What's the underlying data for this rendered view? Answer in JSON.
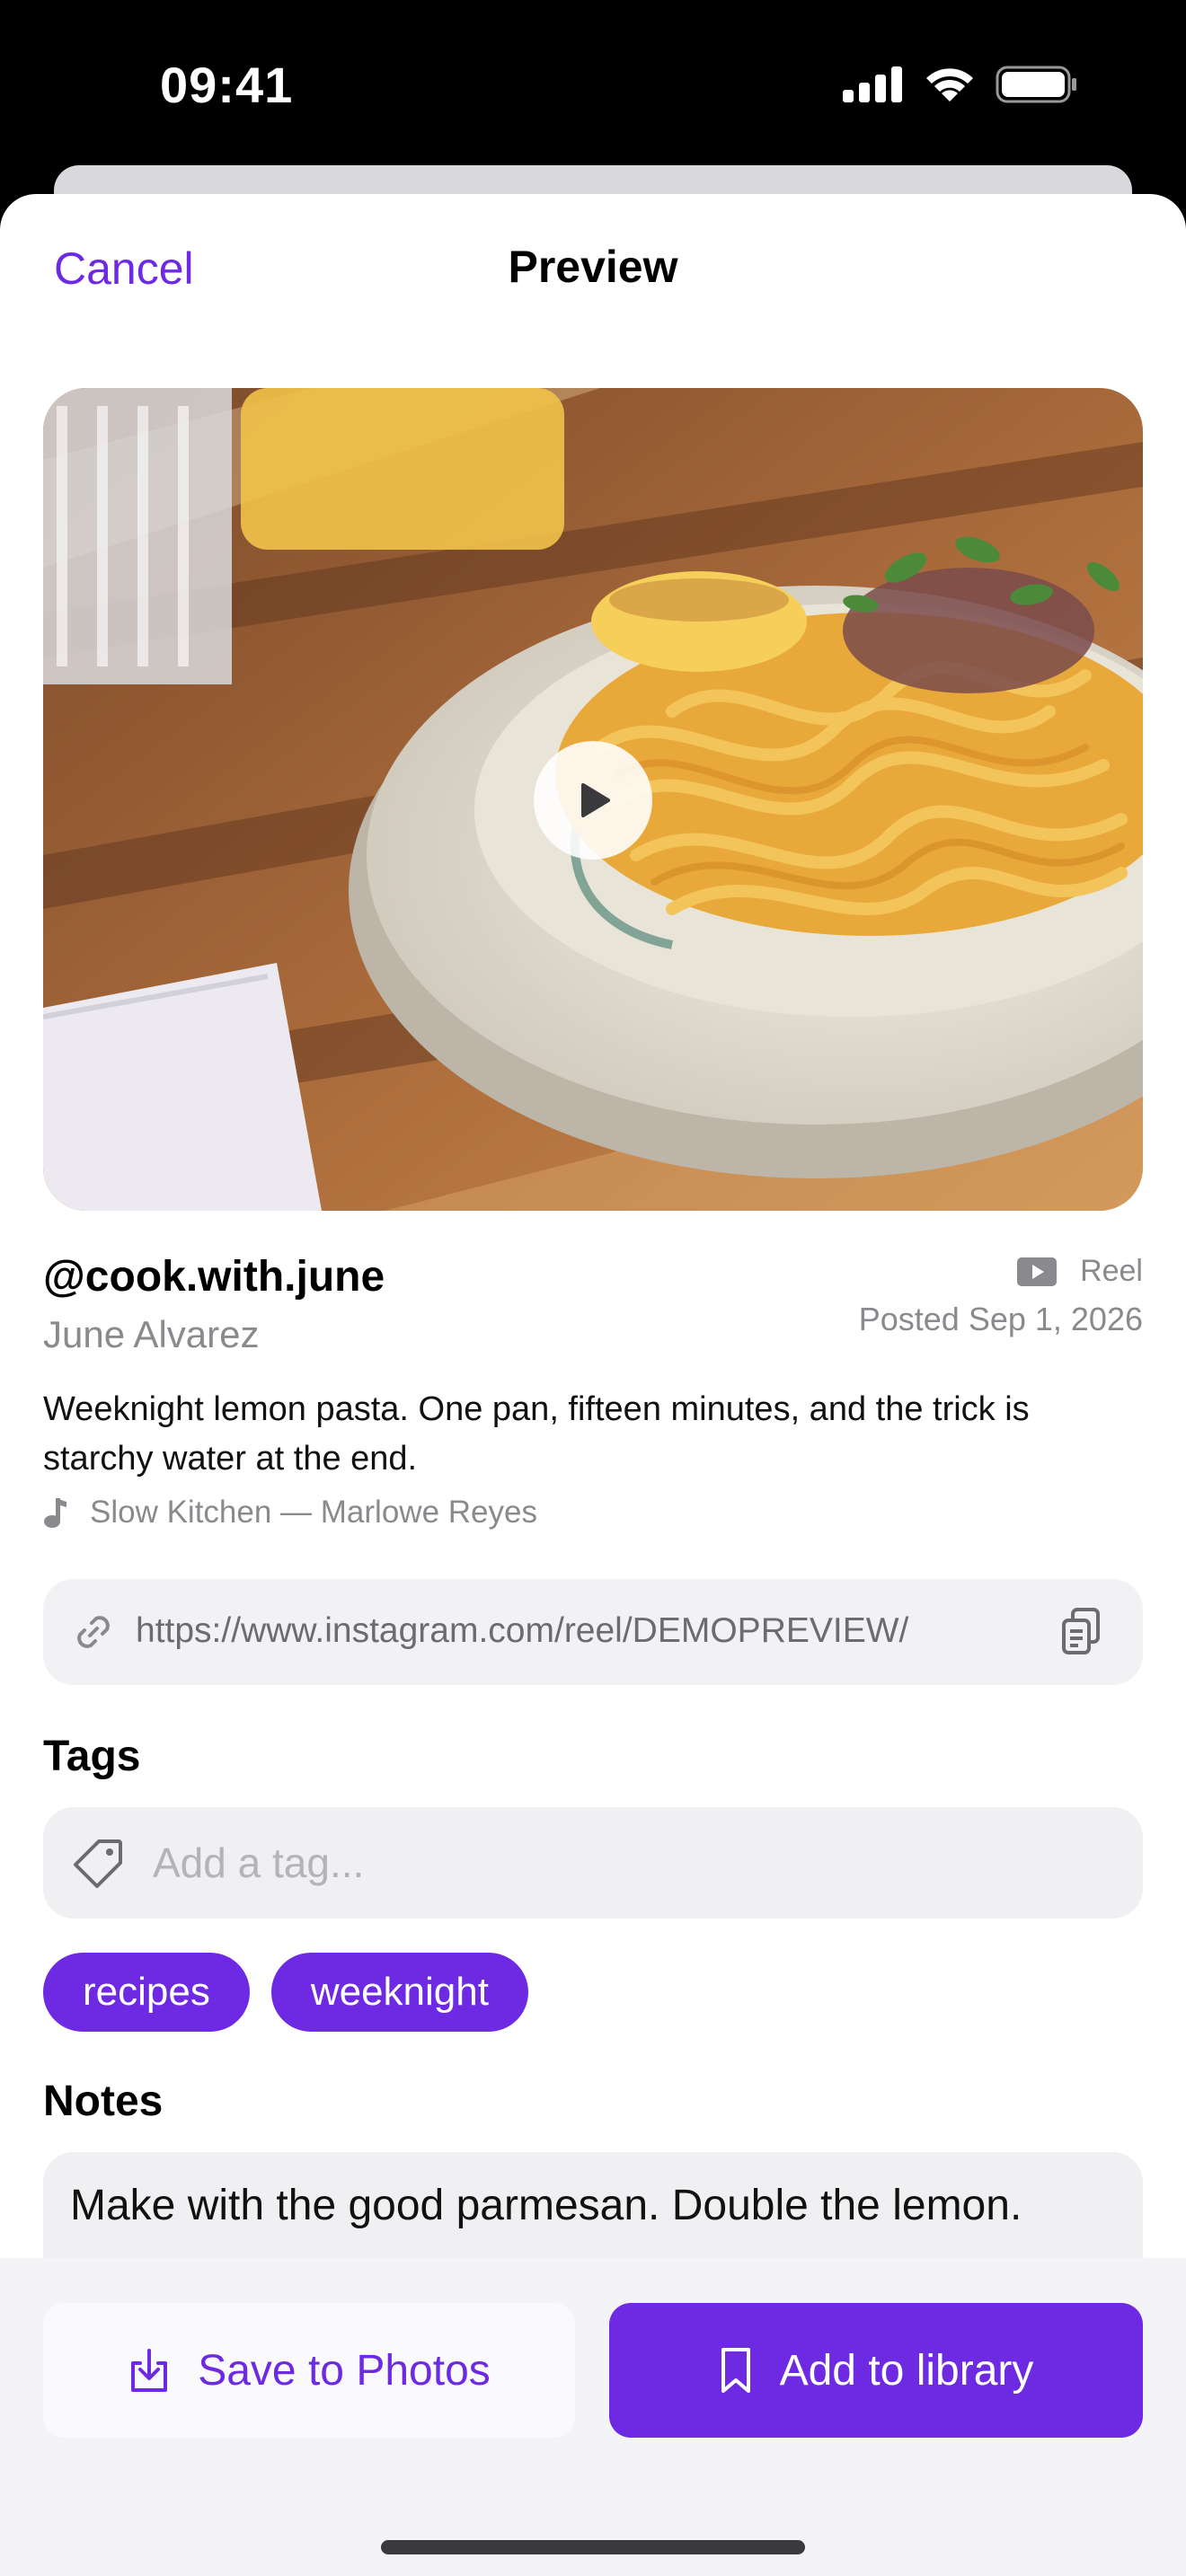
{
  "status_bar": {
    "time": "09:41",
    "icons": [
      "cellular-signal-icon",
      "wifi-icon",
      "battery-icon"
    ]
  },
  "nav": {
    "cancel_label": "Cancel",
    "title": "Preview"
  },
  "media": {
    "icon": "play-icon"
  },
  "post": {
    "handle": "@cook.with.june",
    "author_name": "June Alvarez",
    "type_label": "Reel",
    "type_icon": "reel-icon",
    "posted": "Posted Sep 1, 2026",
    "caption": "Weeknight lemon pasta. One pan, fifteen minutes, and the trick is starchy water at the end.",
    "audio": "Slow Kitchen — Marlowe Reyes",
    "audio_icon": "music-note-icon"
  },
  "link": {
    "url": "https://www.instagram.com/reel/DEMOPREVIEW/",
    "icons": [
      "link-icon",
      "copy-icon"
    ]
  },
  "tags": {
    "title": "Tags",
    "placeholder": "Add a tag...",
    "input_value": "",
    "items": [
      "recipes",
      "weeknight"
    ]
  },
  "notes": {
    "title": "Notes",
    "text": "Make with the good parmesan. Double the lemon."
  },
  "actions": {
    "save_label": "Save to Photos",
    "add_label": "Add to library"
  },
  "colors": {
    "accent": "#6d2ae2",
    "field_background": "#f0f0f2",
    "secondary_text": "#8a8a8e"
  }
}
